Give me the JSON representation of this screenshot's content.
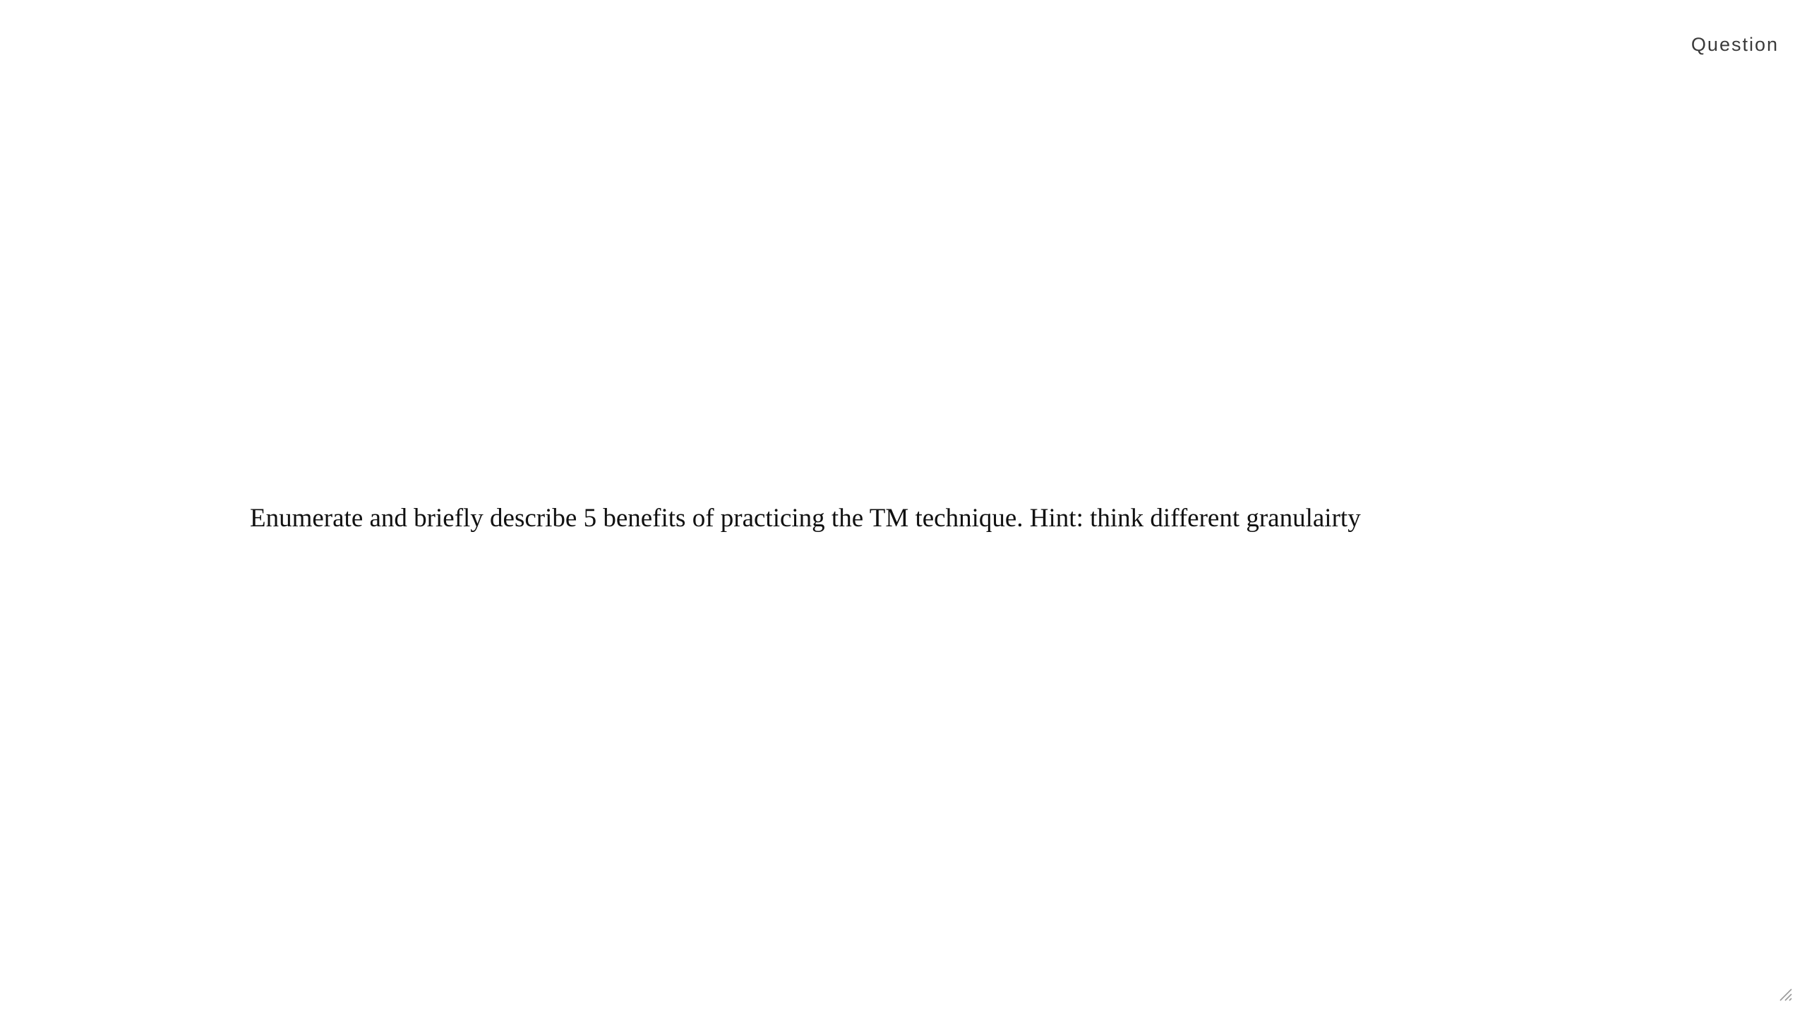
{
  "card": {
    "label": "Question",
    "question": "Enumerate and briefly describe 5 benefits of practicing the TM technique. Hint: think different granulairty"
  },
  "icons": {
    "resize_handle": "resize-grip-icon"
  },
  "colors": {
    "background": "#ffffff",
    "text": "#111111",
    "label": "#3a3a3a",
    "handle": "#9a9a9a"
  }
}
